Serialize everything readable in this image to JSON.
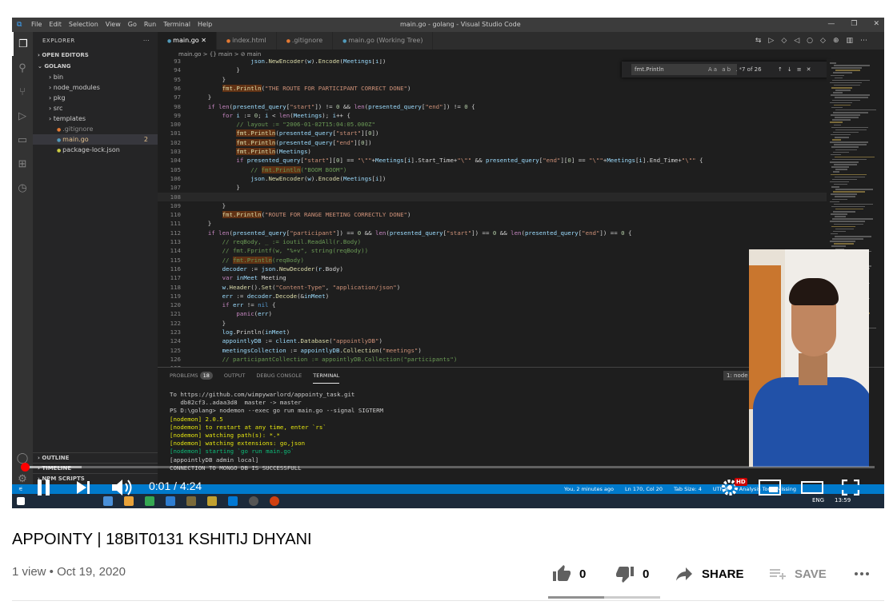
{
  "vscode": {
    "window_title": "main.go - golang - Visual Studio Code",
    "menu": [
      "File",
      "Edit",
      "Selection",
      "View",
      "Go",
      "Run",
      "Terminal",
      "Help"
    ],
    "explorer_title": "EXPLORER",
    "open_editors": "OPEN EDITORS",
    "folder": "GOLANG",
    "files": [
      {
        "name": "bin",
        "type": "folder"
      },
      {
        "name": "node_modules",
        "type": "folder"
      },
      {
        "name": "pkg",
        "type": "folder"
      },
      {
        "name": "src",
        "type": "folder"
      },
      {
        "name": "templates",
        "type": "folder"
      },
      {
        "name": ".gitignore",
        "type": "file"
      },
      {
        "name": "main.go",
        "type": "file",
        "badge": "2"
      },
      {
        "name": "package-lock.json",
        "type": "file"
      }
    ],
    "outline": "OUTLINE",
    "timeline": "TIMELINE",
    "npm_scripts": "NPM SCRIPTS",
    "tabs": [
      "main.go",
      "index.html",
      ".gitignore",
      "main.go (Working Tree)"
    ],
    "breadcrumb": "main.go > {} main > ⊘ main",
    "find": {
      "query": "fmt.Println",
      "count": "7 of 26",
      "options": "Aa ab .*"
    },
    "code_lines": [
      {
        "n": "93",
        "t": "                json.NewEncoder(w).Encode(Meetings[i])"
      },
      {
        "n": "94",
        "t": "            }"
      },
      {
        "n": "95",
        "t": "        }"
      },
      {
        "n": "96",
        "t": "        fmt.Println(\"THE ROUTE FOR PARTICIPANT CORRECT DONE\")"
      },
      {
        "n": "97",
        "t": "    }"
      },
      {
        "n": "98",
        "t": "    if len(presented_query[\"start\"]) != 0 && len(presented_query[\"end\"]) != 0 {"
      },
      {
        "n": "99",
        "t": "        for i := 0; i < len(Meetings); i++ {"
      },
      {
        "n": "100",
        "t": "            // layout := \"2006-01-02T15:04:05.000Z\""
      },
      {
        "n": "101",
        "t": "            fmt.Println(presented_query[\"start\"][0])"
      },
      {
        "n": "102",
        "t": "            fmt.Println(presented_query[\"end\"][0])"
      },
      {
        "n": "103",
        "t": "            fmt.Println(Meetings)"
      },
      {
        "n": "104",
        "t": "            if presented_query[\"start\"][0] == \"\\\"\"+Meetings[i].Start_Time+\"\\\"\" && presented_query[\"end\"][0] == \"\\\"\"+Meetings[i].End_Time+\"\\\"\" {"
      },
      {
        "n": "105",
        "t": "                // fmt.Println(\"BOOM BOOM\")"
      },
      {
        "n": "106",
        "t": "                json.NewEncoder(w).Encode(Meetings[i])"
      },
      {
        "n": "107",
        "t": "            }"
      },
      {
        "n": "108",
        "t": ""
      },
      {
        "n": "109",
        "t": "        }"
      },
      {
        "n": "110",
        "t": "        fmt.Println(\"ROUTE FOR RANGE MEETING CORRECTLY DONE\")"
      },
      {
        "n": "111",
        "t": "    }"
      },
      {
        "n": "112",
        "t": "    if len(presented_query[\"participant\"]) == 0 && len(presented_query[\"start\"]) == 0 && len(presented_query[\"end\"]) == 0 {"
      },
      {
        "n": "113",
        "t": "        // reqBody, _ := ioutil.ReadAll(r.Body)"
      },
      {
        "n": "114",
        "t": "        // fmt.Fprintf(w, \"%+v\", string(reqBody))"
      },
      {
        "n": "115",
        "t": "        // fmt.Println(reqBody)"
      },
      {
        "n": "116",
        "t": "        decoder := json.NewDecoder(r.Body)"
      },
      {
        "n": "117",
        "t": "        var inMeet Meeting"
      },
      {
        "n": "118",
        "t": "        w.Header().Set(\"Content-Type\", \"application/json\")"
      },
      {
        "n": "119",
        "t": "        err := decoder.Decode(&inMeet)"
      },
      {
        "n": "120",
        "t": "        if err != nil {"
      },
      {
        "n": "121",
        "t": "            panic(err)"
      },
      {
        "n": "122",
        "t": "        }"
      },
      {
        "n": "123",
        "t": "        log.Println(inMeet)"
      },
      {
        "n": "124",
        "t": "        appointlyDB := client.Database(\"appointlyDB\")"
      },
      {
        "n": "125",
        "t": "        meetingsCollection := appointlyDB.Collection(\"meetings\")"
      },
      {
        "n": "126",
        "t": "        // participantCollection := appointlyDB.Collection(\"participants\")"
      },
      {
        "n": "127",
        "t": ""
      }
    ],
    "panel_tabs": {
      "problems": "PROBLEMS",
      "problems_count": "18",
      "output": "OUTPUT",
      "debug": "DEBUG CONSOLE",
      "terminal": "TERMINAL",
      "node_select": "1: node"
    },
    "terminal_lines": [
      {
        "t": "To https://github.com/wimpywarlord/appointy_task.git",
        "c": ""
      },
      {
        "t": "   db82cf3..adaa3d8  master -> master",
        "c": ""
      },
      {
        "t": "PS D:\\golang> nodemon --exec go run main.go --signal SIGTERM",
        "c": ""
      },
      {
        "t": "[nodemon] 2.0.5",
        "c": "y"
      },
      {
        "t": "[nodemon] to restart at any time, enter `rs`",
        "c": "y"
      },
      {
        "t": "[nodemon] watching path(s): *.*",
        "c": "y"
      },
      {
        "t": "[nodemon] watching extensions: go,json",
        "c": "y"
      },
      {
        "t": "[nodemon] starting `go run main.go`",
        "c": "g"
      },
      {
        "t": "[appointlyDB admin local]",
        "c": ""
      },
      {
        "t": "CONNECTION TO MONGO DB IS SUCCESSFULL",
        "c": ""
      }
    ],
    "status_right": [
      "You, 2 minutes ago",
      "Ln 170, Col 20",
      "Tab Size: 4",
      "UTF-8",
      "Analysis Tools Missing"
    ],
    "clock": "13:59",
    "lang": "ENG"
  },
  "player": {
    "current_time": "0:01 / 4:24",
    "hd_badge": "HD",
    "progress": 0.004,
    "buffered": 0.07
  },
  "video": {
    "title": "APPOINTY | 18BIT0131 KSHITIJ DHYANI",
    "meta": "1 view • Oct 19, 2020",
    "likes": "0",
    "dislikes": "0",
    "share": "SHARE",
    "save": "SAVE"
  },
  "colors": {
    "progress": "#ff0000",
    "vscode_status": "#007acc"
  }
}
